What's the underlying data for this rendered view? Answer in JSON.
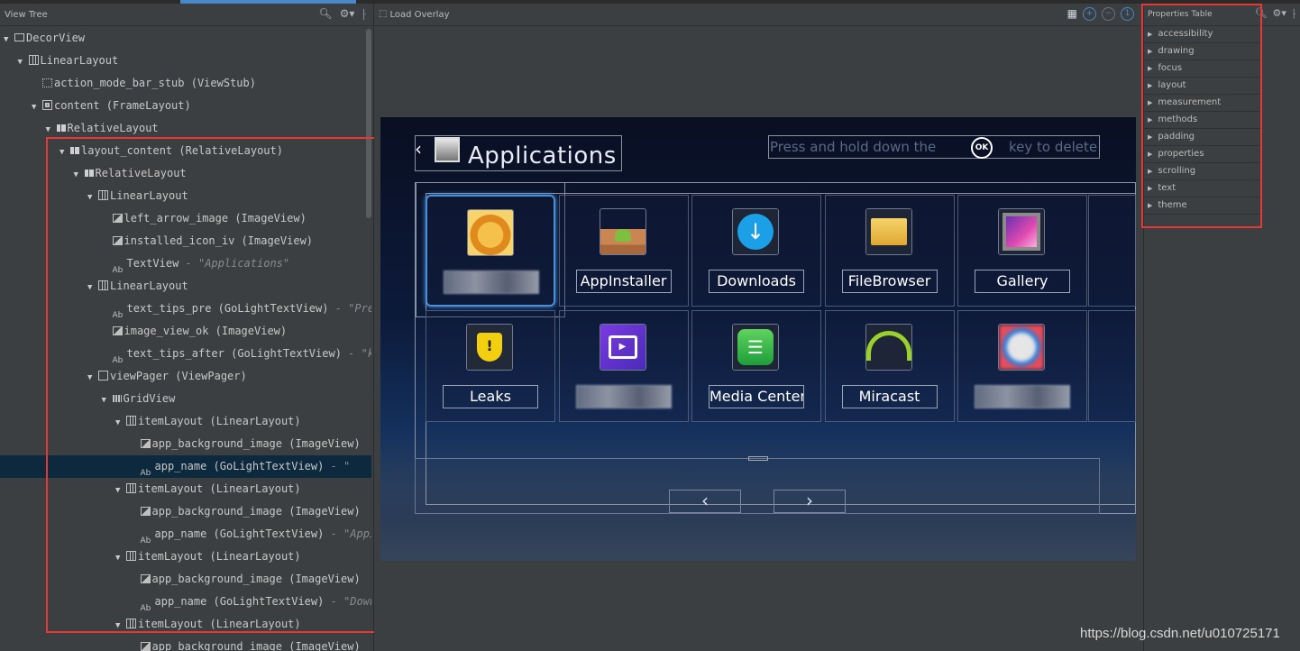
{
  "view_tree": {
    "title": "View Tree",
    "rows": [
      {
        "indent": 0,
        "arrow": "▼",
        "icon": "box",
        "name": "DecorView",
        "extra": ""
      },
      {
        "indent": 1,
        "arrow": "▼",
        "icon": "lin",
        "name": "LinearLayout",
        "extra": ""
      },
      {
        "indent": 2,
        "arrow": "",
        "icon": "stub",
        "name": "action_mode_bar_stub (ViewStub)",
        "extra": ""
      },
      {
        "indent": 2,
        "arrow": "▼",
        "icon": "frame",
        "name": "content (FrameLayout)",
        "extra": ""
      },
      {
        "indent": 3,
        "arrow": "▼",
        "icon": "rel",
        "name": "RelativeLayout",
        "extra": ""
      },
      {
        "indent": 4,
        "arrow": "▼",
        "icon": "rel",
        "name": "layout_content (RelativeLayout)",
        "extra": ""
      },
      {
        "indent": 5,
        "arrow": "▼",
        "icon": "rel",
        "name": "RelativeLayout",
        "extra": ""
      },
      {
        "indent": 6,
        "arrow": "▼",
        "icon": "lin",
        "name": "LinearLayout",
        "extra": ""
      },
      {
        "indent": 7,
        "arrow": "",
        "icon": "img",
        "name": "left_arrow_image (ImageView)",
        "extra": ""
      },
      {
        "indent": 7,
        "arrow": "",
        "icon": "img",
        "name": "installed_icon_iv (ImageView)",
        "extra": ""
      },
      {
        "indent": 7,
        "arrow": "",
        "icon": "txt",
        "name": "TextView",
        "extra": " - \"Applications\""
      },
      {
        "indent": 6,
        "arrow": "▼",
        "icon": "lin",
        "name": "LinearLayout",
        "extra": ""
      },
      {
        "indent": 7,
        "arrow": "",
        "icon": "txt",
        "name": "text_tips_pre (GoLightTextView)",
        "extra": " - \"Press"
      },
      {
        "indent": 7,
        "arrow": "",
        "icon": "img",
        "name": "image_view_ok (ImageView)",
        "extra": ""
      },
      {
        "indent": 7,
        "arrow": "",
        "icon": "txt",
        "name": "text_tips_after (GoLightTextView)",
        "extra": " - \"key"
      },
      {
        "indent": 6,
        "arrow": "▼",
        "icon": "pager",
        "name": "viewPager (ViewPager)",
        "extra": ""
      },
      {
        "indent": 7,
        "arrow": "▼",
        "icon": "grid",
        "name": "GridView",
        "extra": ""
      },
      {
        "indent": 8,
        "arrow": "▼",
        "icon": "lin",
        "name": "itemLayout (LinearLayout)",
        "extra": ""
      },
      {
        "indent": 9,
        "arrow": "",
        "icon": "img",
        "name": "app_background_image (ImageView)",
        "extra": ""
      },
      {
        "indent": 9,
        "arrow": "",
        "icon": "txt",
        "name": "app_name (GoLightTextView)",
        "extra": " - \"",
        "selected": true
      },
      {
        "indent": 8,
        "arrow": "▼",
        "icon": "lin",
        "name": "itemLayout (LinearLayout)",
        "extra": ""
      },
      {
        "indent": 9,
        "arrow": "",
        "icon": "img",
        "name": "app_background_image (ImageView)",
        "extra": ""
      },
      {
        "indent": 9,
        "arrow": "",
        "icon": "txt",
        "name": "app_name (GoLightTextView)",
        "extra": " - \"AppIn"
      },
      {
        "indent": 8,
        "arrow": "▼",
        "icon": "lin",
        "name": "itemLayout (LinearLayout)",
        "extra": ""
      },
      {
        "indent": 9,
        "arrow": "",
        "icon": "img",
        "name": "app_background_image (ImageView)",
        "extra": ""
      },
      {
        "indent": 9,
        "arrow": "",
        "icon": "txt",
        "name": "app_name (GoLightTextView)",
        "extra": " - \"Downl"
      },
      {
        "indent": 8,
        "arrow": "▼",
        "icon": "lin",
        "name": "itemLayout (LinearLayout)",
        "extra": ""
      },
      {
        "indent": 9,
        "arrow": "",
        "icon": "img",
        "name": "app_background_image (ImageView)",
        "extra": ""
      }
    ]
  },
  "overlay": {
    "load_label": "Load Overlay"
  },
  "device": {
    "title": "Applications",
    "tips_pre": "Press and hold down the",
    "ok_label": "OK",
    "tips_after": "key to delete",
    "apps_row1": [
      {
        "label": "",
        "icon": "lion",
        "blurred": true
      },
      {
        "label": "AppInstaller",
        "icon": "box"
      },
      {
        "label": "Downloads",
        "icon": "download"
      },
      {
        "label": "FileBrowser",
        "icon": "folder"
      },
      {
        "label": "Gallery",
        "icon": "gallery"
      }
    ],
    "apps_row2": [
      {
        "label": "Leaks",
        "icon": "shield"
      },
      {
        "label": "",
        "icon": "tv",
        "blurred": true
      },
      {
        "label": "Media Center",
        "icon": "media"
      },
      {
        "label": "Miracast",
        "icon": "wifi"
      },
      {
        "label": "",
        "icon": "blurred",
        "blurred": true
      }
    ],
    "prev_label": "‹",
    "next_label": "›"
  },
  "properties": {
    "title": "Properties Table",
    "items": [
      "accessibility",
      "drawing",
      "focus",
      "layout",
      "measurement",
      "methods",
      "padding",
      "properties",
      "scrolling",
      "text",
      "theme"
    ]
  },
  "watermark": "https://blog.csdn.net/u010725171"
}
